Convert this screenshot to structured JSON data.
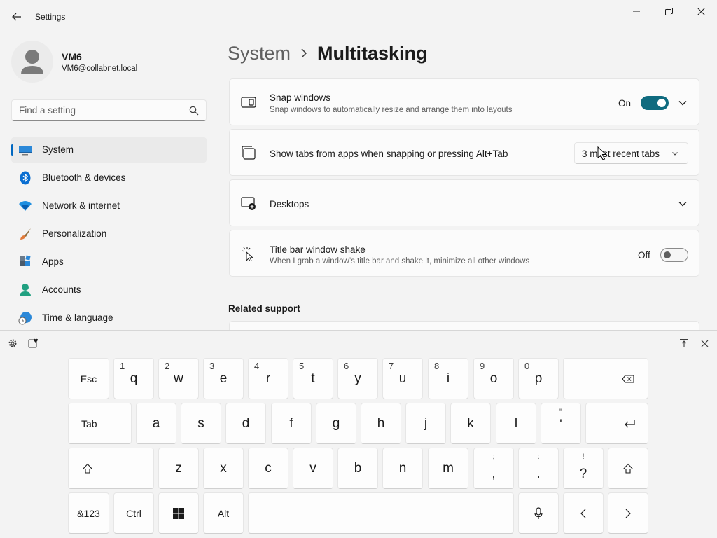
{
  "window": {
    "title": "Settings"
  },
  "user": {
    "name": "VM6",
    "email": "VM6@collabnet.local"
  },
  "search": {
    "placeholder": "Find a setting"
  },
  "sidebar": {
    "items": [
      {
        "label": "System",
        "icon": "system-icon",
        "selected": true
      },
      {
        "label": "Bluetooth & devices",
        "icon": "bluetooth-icon"
      },
      {
        "label": "Network & internet",
        "icon": "wifi-icon"
      },
      {
        "label": "Personalization",
        "icon": "brush-icon"
      },
      {
        "label": "Apps",
        "icon": "apps-icon"
      },
      {
        "label": "Accounts",
        "icon": "accounts-icon"
      },
      {
        "label": "Time & language",
        "icon": "globe-clock-icon"
      }
    ]
  },
  "breadcrumb": {
    "parent": "System",
    "current": "Multitasking"
  },
  "settings": {
    "snap": {
      "title": "Snap windows",
      "desc": "Snap windows to automatically resize and arrange them into layouts",
      "state_label": "On",
      "on": true
    },
    "tabs": {
      "title": "Show tabs from apps when snapping or pressing Alt+Tab",
      "value": "3 most recent tabs"
    },
    "desktops": {
      "title": "Desktops"
    },
    "shake": {
      "title": "Title bar window shake",
      "desc": "When I grab a window’s title bar and shake it, minimize all other windows",
      "state_label": "Off",
      "on": false
    }
  },
  "related": {
    "heading": "Related support"
  },
  "keyboard": {
    "row1": {
      "esc": "Esc",
      "letters": [
        {
          "hint": "1",
          "char": "q"
        },
        {
          "hint": "2",
          "char": "w"
        },
        {
          "hint": "3",
          "char": "e"
        },
        {
          "hint": "4",
          "char": "r"
        },
        {
          "hint": "5",
          "char": "t"
        },
        {
          "hint": "6",
          "char": "y"
        },
        {
          "hint": "7",
          "char": "u"
        },
        {
          "hint": "8",
          "char": "i"
        },
        {
          "hint": "9",
          "char": "o"
        },
        {
          "hint": "0",
          "char": "p"
        }
      ]
    },
    "row2": {
      "tab": "Tab",
      "letters": [
        "a",
        "s",
        "d",
        "f",
        "g",
        "h",
        "j",
        "k",
        "l"
      ],
      "quote": {
        "sup": "\"",
        "main": "'"
      }
    },
    "row3": {
      "letters": [
        "z",
        "x",
        "c",
        "v",
        "b",
        "n",
        "m"
      ],
      "punct": [
        {
          "sup": ";",
          "main": ","
        },
        {
          "sup": ":",
          "main": "."
        },
        {
          "sup": "!",
          "main": "?"
        }
      ]
    },
    "row4": {
      "sym": "&123",
      "ctrl": "Ctrl",
      "alt": "Alt"
    }
  },
  "colors": {
    "accent": "#0f6b7f",
    "selection_indicator": "#0067c0",
    "background": "#f3f3f3",
    "card": "#fbfbfb"
  }
}
